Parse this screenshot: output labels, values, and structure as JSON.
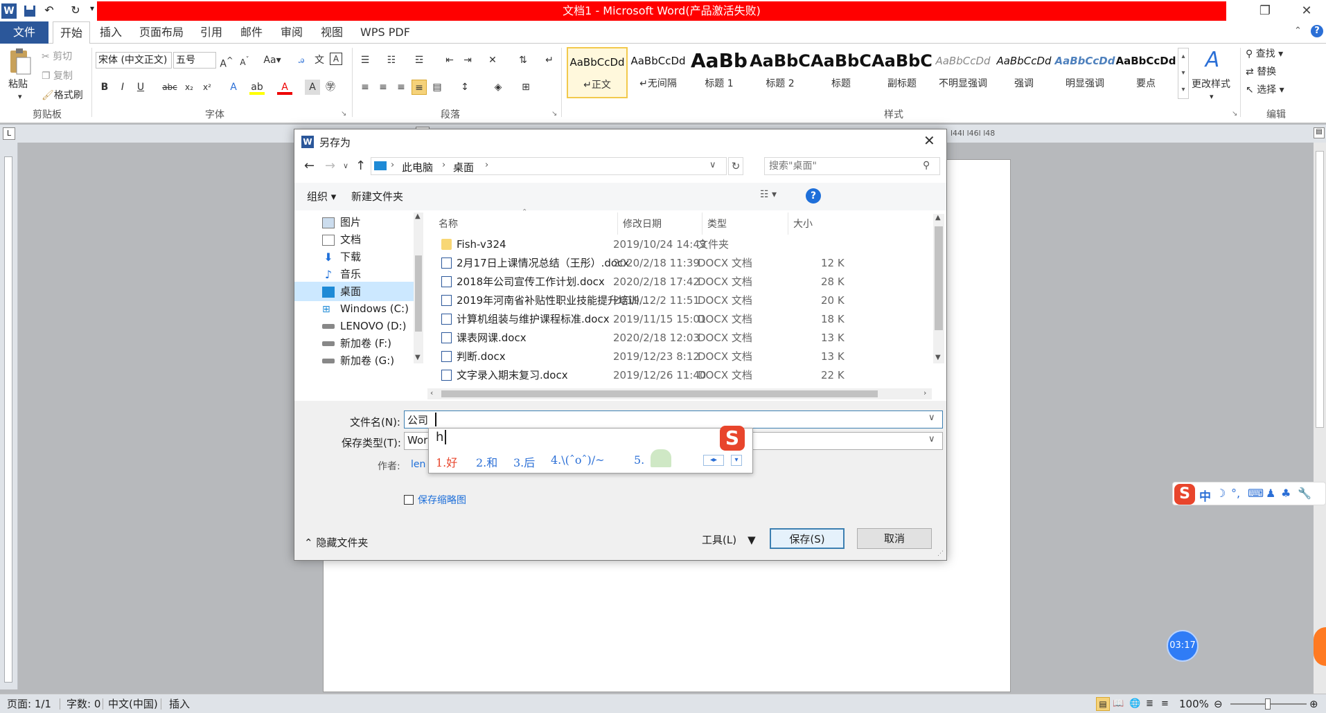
{
  "window": {
    "title": "文档1 - Microsoft Word(产品激活失败)"
  },
  "tabs": [
    "文件",
    "开始",
    "插入",
    "页面布局",
    "引用",
    "邮件",
    "审阅",
    "视图",
    "WPS PDF"
  ],
  "clipboard": {
    "paste": "粘贴",
    "cut": "剪切",
    "copy": "复制",
    "format_painter": "格式刷",
    "label": "剪贴板"
  },
  "font": {
    "name": "宋体 (中文正文)",
    "size": "五号",
    "label": "字体"
  },
  "paragraph": {
    "label": "段落"
  },
  "styles": {
    "label": "样式",
    "change": "更改样式",
    "items": [
      {
        "sample": "AaBbCcDd",
        "name": "↵正文"
      },
      {
        "sample": "AaBbCcDd",
        "name": "↵无间隔"
      },
      {
        "sample": "AaBb",
        "name": "标题 1"
      },
      {
        "sample": "AaBbC",
        "name": "标题 2"
      },
      {
        "sample": "AaBbC",
        "name": "标题"
      },
      {
        "sample": "AaBbC",
        "name": "副标题"
      },
      {
        "sample": "AaBbCcDd",
        "name": "不明显强调"
      },
      {
        "sample": "AaBbCcDd",
        "name": "强调"
      },
      {
        "sample": "AaBbCcDd",
        "name": "明显强调"
      },
      {
        "sample": "AaBbCcDd",
        "name": "要点"
      }
    ]
  },
  "editing": {
    "find": "查找",
    "replace": "替换",
    "select": "选择",
    "label": "编辑"
  },
  "ruler": {
    "top_marks": "l44l  l46l  l48"
  },
  "dialog": {
    "title": "另存为",
    "breadcrumb": [
      "此电脑",
      "桌面"
    ],
    "search_placeholder": "搜索\"桌面\"",
    "organize": "组织 ▾",
    "new_folder": "新建文件夹",
    "tree": [
      "图片",
      "文档",
      "下载",
      "音乐",
      "桌面",
      "Windows (C:)",
      "LENOVO (D:)",
      "新加卷 (F:)",
      "新加卷 (G:)"
    ],
    "columns": {
      "name": "名称",
      "date": "修改日期",
      "type": "类型",
      "size": "大小"
    },
    "files": [
      {
        "name": "Fish-v324",
        "date": "2019/10/24 14:43",
        "type": "文件夹",
        "size": ""
      },
      {
        "name": "2月17日上课情况总结（王彤）.docx",
        "date": "2020/2/18 11:39",
        "type": "DOCX 文档",
        "size": "12 K"
      },
      {
        "name": "2018年公司宣传工作计划.docx",
        "date": "2020/2/18 17:42",
        "type": "DOCX 文档",
        "size": "28 K"
      },
      {
        "name": "2019年河南省补贴性职业技能提升培训...",
        "date": "2019/12/2 11:51",
        "type": "DOCX 文档",
        "size": "20 K"
      },
      {
        "name": "计算机组装与维护课程标准.docx",
        "date": "2019/11/15 15:01",
        "type": "DOCX 文档",
        "size": "18 K"
      },
      {
        "name": "课表网课.docx",
        "date": "2020/2/18 12:03",
        "type": "DOCX 文档",
        "size": "13 K"
      },
      {
        "name": "判断.docx",
        "date": "2019/12/23 8:12",
        "type": "DOCX 文档",
        "size": "13 K"
      },
      {
        "name": "文字录入期末复习.docx",
        "date": "2019/12/26 11:40",
        "type": "DOCX 文档",
        "size": "22 K"
      }
    ],
    "filename_label": "文件名(N):",
    "filename_value": "公司",
    "filetype_label": "保存类型(T):",
    "filetype_value": "Wor",
    "author_label": "作者:",
    "author_value": "len",
    "thumbnail": "保存缩略图",
    "hide_folders": "隐藏文件夹",
    "tools": "工具(L)",
    "save": "保存(S)",
    "cancel": "取消"
  },
  "ime": {
    "input": "h",
    "candidates": [
      "1.好",
      "2.和",
      "3.后",
      "4.\\(ˆoˆ)/~",
      "5."
    ]
  },
  "ime_toolbar": {
    "mode": "中"
  },
  "timer": "03:17",
  "status": {
    "page": "页面: 1/1",
    "words": "字数: 0",
    "lang": "中文(中国)",
    "mode": "插入",
    "zoom": "100%"
  },
  "colors": {
    "accent": "#2b579a",
    "title_red": "#ff0000",
    "ime_red": "#e8452c"
  }
}
